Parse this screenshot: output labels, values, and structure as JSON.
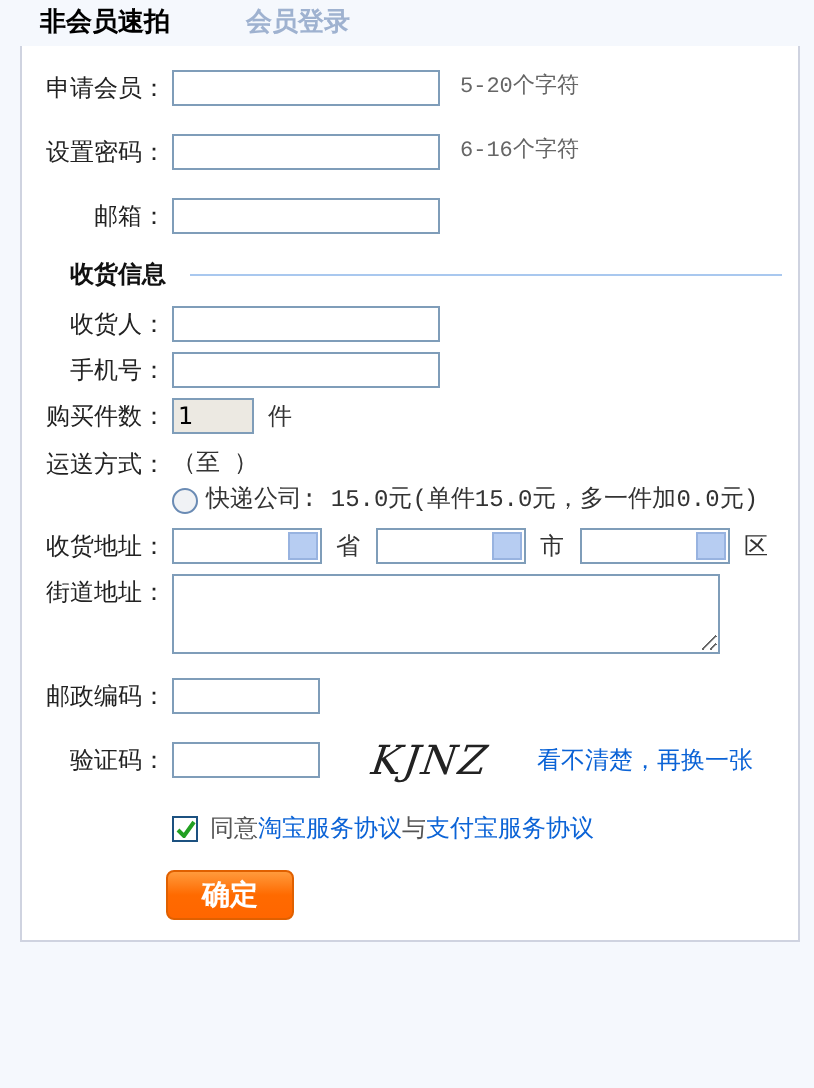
{
  "tabs": [
    {
      "label": "非会员速拍",
      "selected": true
    },
    {
      "label": "会员登录",
      "selected": false
    }
  ],
  "account_fields": [
    {
      "label": "申请会员：",
      "hint": "5-20个字符"
    },
    {
      "label": "设置密码：",
      "hint": "6-16个字符"
    },
    {
      "label": "邮箱："
    }
  ],
  "section_title": "收货信息",
  "contact_fields": [
    {
      "label": "收货人："
    },
    {
      "label": "手机号："
    }
  ],
  "quantity": {
    "label": "购买件数：",
    "value": "1",
    "unit": "件"
  },
  "shipping": {
    "label": "运送方式：",
    "route": "（至  ）",
    "options": [
      {
        "text": "快递公司: 15.0元(单件15.0元，多一件加0.0元)",
        "selected": false
      }
    ]
  },
  "region": {
    "label": "收货地址：",
    "selects": [
      {
        "unit": "省"
      },
      {
        "unit": "市"
      },
      {
        "unit": "区"
      }
    ]
  },
  "street": {
    "label": "街道地址："
  },
  "postcode": {
    "label": "邮政编码："
  },
  "captcha": {
    "label": "验证码：",
    "image_text": "KJNZ",
    "refresh_link": "看不清楚，再换一张"
  },
  "agreement": {
    "checked": true,
    "before": "同意",
    "links": [
      "淘宝服务协议",
      "支付宝服务协议"
    ],
    "joiner": "与"
  },
  "submit": "确定"
}
